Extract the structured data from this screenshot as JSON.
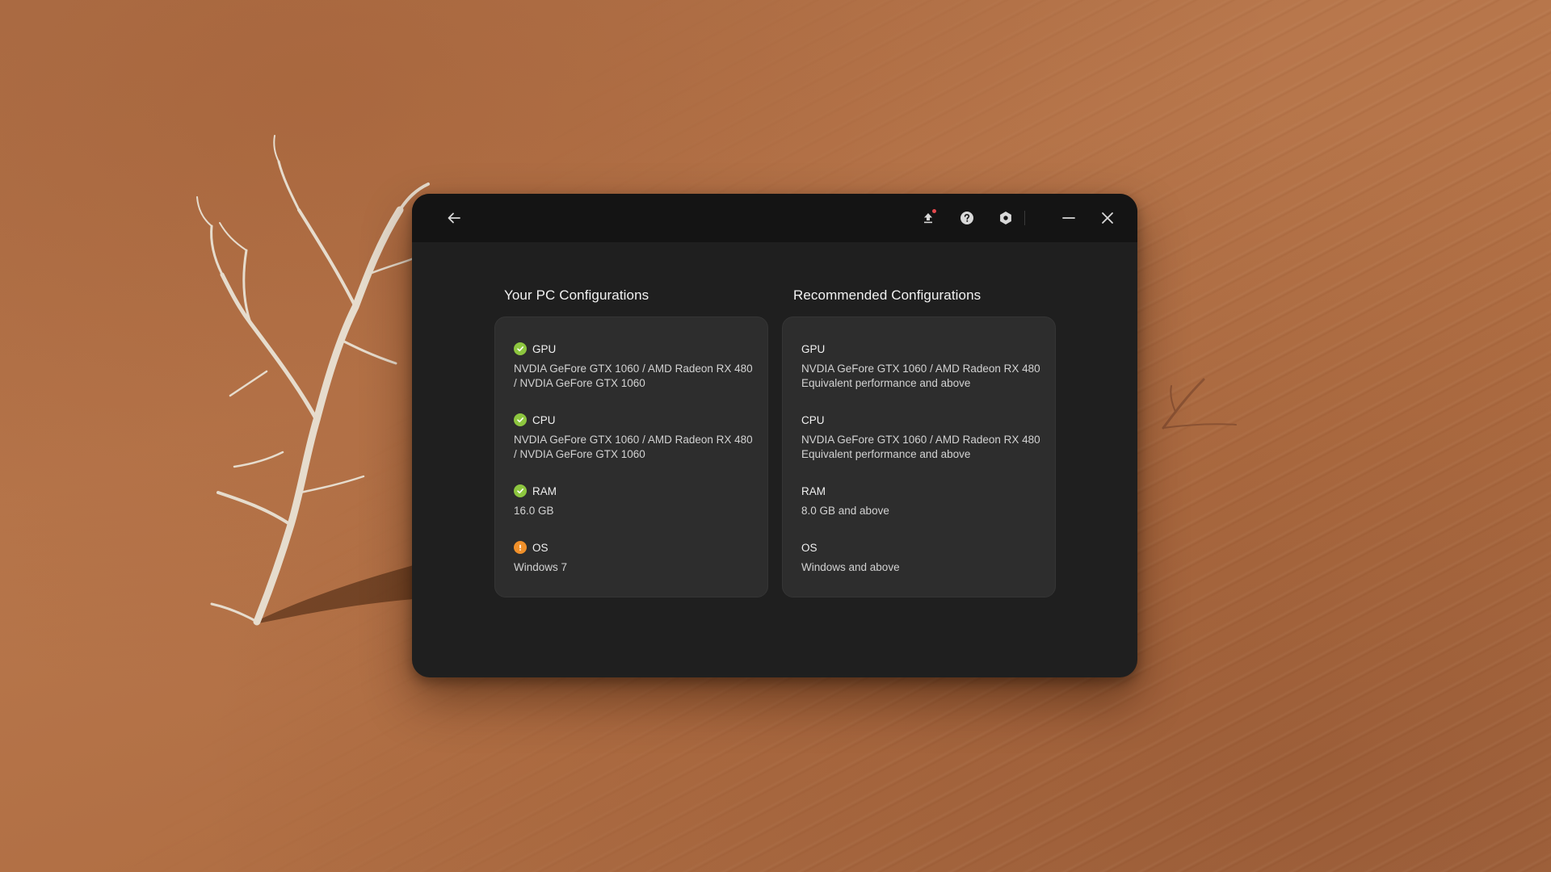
{
  "window": {
    "titlebar": {
      "back": {
        "icon": "arrow-left-icon",
        "label": "Back"
      },
      "actions": [
        {
          "icon": "upload-icon",
          "has_notification": true
        },
        {
          "icon": "help-icon"
        },
        {
          "icon": "settings-icon"
        }
      ],
      "minimize": {
        "icon": "minimize-icon"
      },
      "close": {
        "icon": "close-icon"
      }
    },
    "your_pc": {
      "title": "Your PC Configurations",
      "items": [
        {
          "label": "GPU",
          "status": "ok",
          "value": "NVDIA GeFore GTX 1060 / AMD Radeon RX 480 / NVDIA GeFore GTX 1060"
        },
        {
          "label": "CPU",
          "status": "ok",
          "value": "NVDIA GeFore GTX 1060 / AMD Radeon RX 480 / NVDIA GeFore GTX 1060"
        },
        {
          "label": "RAM",
          "status": "ok",
          "value": "16.0 GB"
        },
        {
          "label": "OS",
          "status": "warning",
          "value": "Windows 7"
        }
      ]
    },
    "recommended": {
      "title": "Recommended Configurations",
      "items": [
        {
          "label": "GPU",
          "value": "NVDIA GeFore GTX 1060 / AMD Radeon RX 480 Equivalent performance and above"
        },
        {
          "label": "CPU",
          "value": "NVDIA GeFore GTX 1060 / AMD Radeon RX 480 Equivalent performance and above"
        },
        {
          "label": "RAM",
          "value": "8.0 GB and above"
        },
        {
          "label": "OS",
          "value": "Windows and above"
        }
      ]
    }
  },
  "colors": {
    "ok": "#8dc63f",
    "warning": "#f0902a",
    "notification": "#e5484d",
    "icon": "#d9d9d9"
  }
}
